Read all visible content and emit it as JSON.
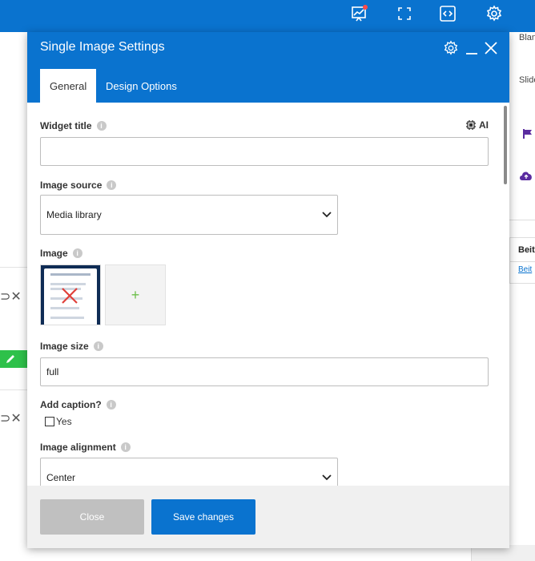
{
  "dialog": {
    "title": "Single Image Settings",
    "tabs": [
      {
        "label": "General",
        "active": true
      },
      {
        "label": "Design Options",
        "active": false
      }
    ]
  },
  "fields": {
    "widget_title": {
      "label": "Widget title",
      "value": "",
      "ai_label": "AI"
    },
    "image_source": {
      "label": "Image source",
      "value": "Media library"
    },
    "image": {
      "label": "Image",
      "add_symbol": "+"
    },
    "image_size": {
      "label": "Image size",
      "value": "full"
    },
    "add_caption": {
      "label": "Add caption?",
      "option": "Yes",
      "checked": false
    },
    "image_alignment": {
      "label": "Image alignment",
      "value": "Center"
    }
  },
  "buttons": {
    "close": "Close",
    "save": "Save changes"
  },
  "background": {
    "right_texts": [
      "Blan",
      "Slide",
      "Beit",
      "Beit"
    ]
  },
  "colors": {
    "brand_blue": "#0a73cf",
    "footer_bg": "#f0f0f0",
    "close_disabled": "#c0c0c0",
    "add_plus": "#6dbf4b",
    "green_bar": "#2ec14a"
  },
  "icons": [
    "insights-icon",
    "fullscreen-icon",
    "code-icon",
    "settings-icon",
    "gear-icon",
    "minimize-icon",
    "close-icon",
    "ai-chip-icon",
    "chevron-down-icon",
    "info-icon",
    "flag-icon",
    "cloud-upload-icon",
    "pencil-icon"
  ]
}
